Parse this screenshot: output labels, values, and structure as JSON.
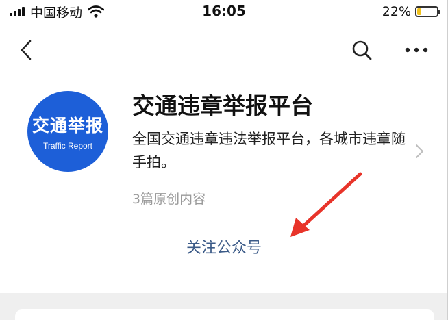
{
  "status_bar": {
    "carrier": "中国移动",
    "time": "16:05",
    "battery_percent": "22%",
    "battery_level": 0.22,
    "battery_color": "#f1c21b"
  },
  "nav": {
    "back_icon": "chevron-left-icon",
    "search_icon": "search-icon",
    "more_icon": "more-icon"
  },
  "account": {
    "logo_text": "交通举报",
    "logo_subtext": "Traffic Report",
    "logo_color": "#1d5fd8",
    "name": "交通违章举报平台",
    "description": "全国交通违章违法举报平台，各城市违章随手拍。",
    "original_count": "3篇原创内容"
  },
  "actions": {
    "follow_label": "关注公众号",
    "follow_color": "#3c5b88"
  },
  "annotation": {
    "arrow_color": "#e8342a"
  }
}
